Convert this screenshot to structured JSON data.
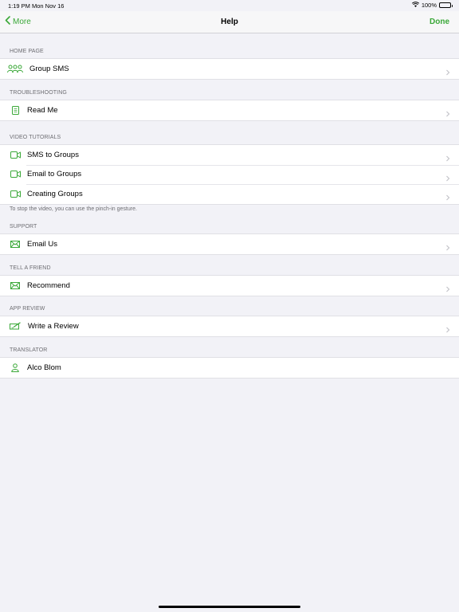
{
  "status_bar": {
    "time": "1:19 PM",
    "date": "Mon Nov 16",
    "battery": "100%",
    "wifi_icon": "wifi-icon",
    "battery_level": 1.0
  },
  "nav": {
    "back_label": "More",
    "title": "Help",
    "done_label": "Done",
    "accent_color": "#3aa838"
  },
  "sections": {
    "home_page": {
      "header": "HOME PAGE",
      "items": [
        {
          "label": "Group SMS",
          "icon": "group-icon"
        }
      ]
    },
    "troubleshooting": {
      "header": "TROUBLESHOOTING",
      "items": [
        {
          "label": "Read Me",
          "icon": "document-icon"
        }
      ]
    },
    "video_tutorials": {
      "header": "VIDEO TUTORIALS",
      "items": [
        {
          "label": "SMS to Groups",
          "icon": "video-icon"
        },
        {
          "label": "Email to Groups",
          "icon": "video-icon"
        },
        {
          "label": "Creating Groups",
          "icon": "video-icon"
        }
      ],
      "footer": "To stop the video, you can use the pinch-in gesture."
    },
    "support": {
      "header": "SUPPORT",
      "items": [
        {
          "label": "Email Us",
          "icon": "envelope-icon"
        }
      ]
    },
    "tell_a_friend": {
      "header": "TELL A FRIEND",
      "items": [
        {
          "label": "Recommend",
          "icon": "envelope-icon"
        }
      ]
    },
    "app_review": {
      "header": "APP REVIEW",
      "items": [
        {
          "label": "Write a Review",
          "icon": "pencil-icon"
        }
      ]
    },
    "translator": {
      "header": "TRANSLATOR",
      "items": [
        {
          "label": "Alco Blom",
          "icon": "person-icon"
        }
      ]
    }
  }
}
